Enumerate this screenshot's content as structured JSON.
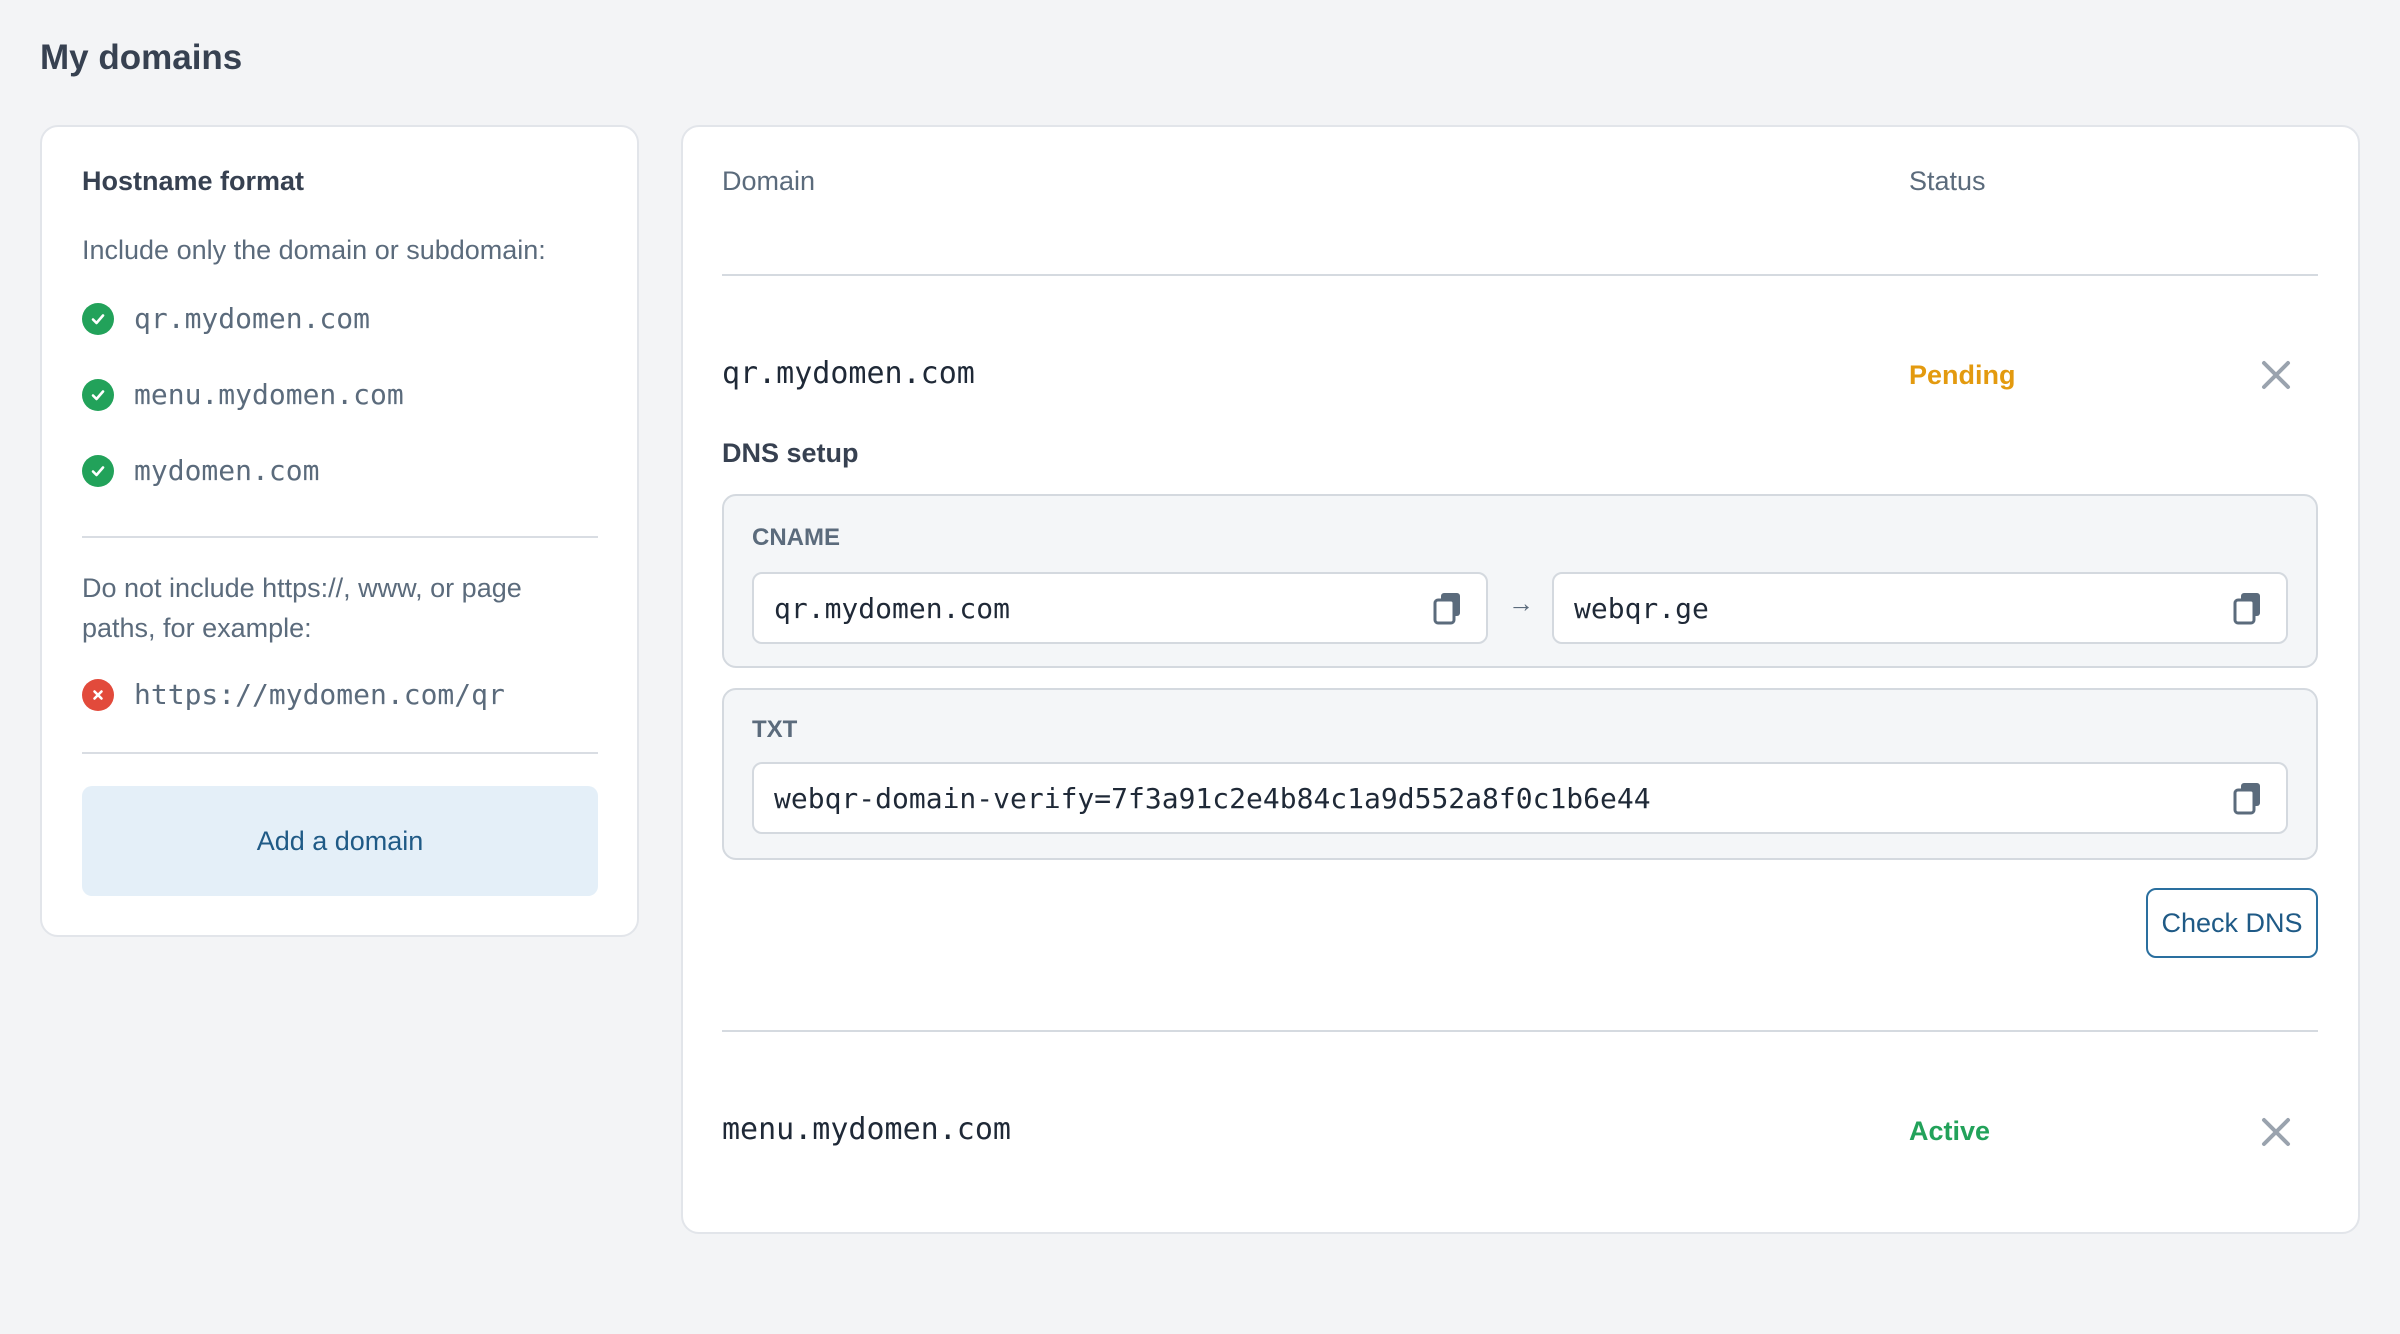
{
  "page": {
    "title": "My domains"
  },
  "hostname_format": {
    "title": "Hostname format",
    "include_text": "Include only the domain or subdomain:",
    "good_examples": [
      "qr.mydomen.com",
      "menu.mydomen.com",
      "mydomen.com"
    ],
    "exclude_text": "Do not include https://, www, or page paths, for example:",
    "bad_examples": [
      "https://mydomen.com/qr"
    ],
    "add_button": "Add a domain"
  },
  "table": {
    "headers": {
      "domain": "Domain",
      "status": "Status"
    },
    "rows": [
      {
        "domain": "qr.mydomen.com",
        "status": "Pending",
        "dns": {
          "title": "DNS setup",
          "cname": {
            "label": "CNAME",
            "from": "qr.mydomen.com",
            "to": "webqr.ge"
          },
          "txt": {
            "label": "TXT",
            "value": "webqr-domain-verify=7f3a91c2e4b84c1a9d552a8f0c1b6e44"
          },
          "check_button": "Check DNS"
        }
      },
      {
        "domain": "menu.mydomen.com",
        "status": "Active"
      }
    ]
  },
  "colors": {
    "pending": "#e39a0f",
    "active": "#22a25a",
    "accent": "#1f5a86",
    "ok": "#22a25a",
    "error": "#e24a3b"
  },
  "icons": {
    "ok": "check-circle-icon",
    "bad": "x-circle-icon",
    "remove": "close-icon",
    "copy": "copy-icon",
    "arrow": "arrow-right-icon"
  }
}
